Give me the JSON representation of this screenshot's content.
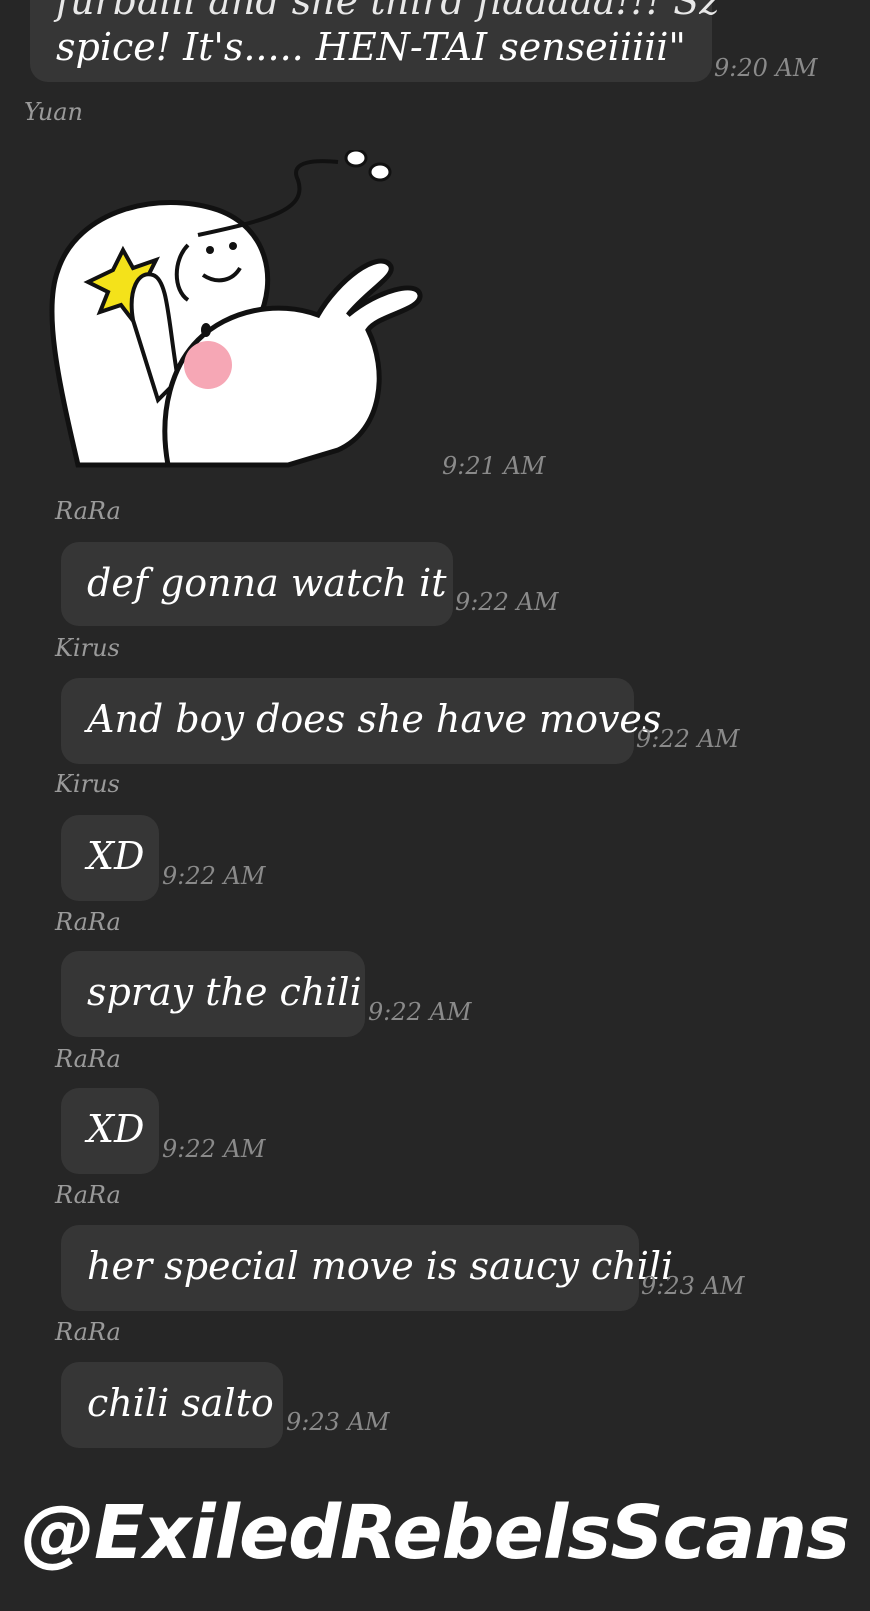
{
  "chat": {
    "top_message": {
      "line1": "furballl and she third flaaaaa!!! Sz",
      "line2": "spice! It's..... HEN-TAI senseiiiii\"",
      "time": "9:20 AM"
    },
    "sticker_message": {
      "sender": "Yuan",
      "time": "9:21 AM",
      "sticker_icon": "hug-sticker-icon"
    },
    "messages": [
      {
        "sender": "RaRa",
        "text": "def gonna watch it",
        "time": "9:22 AM"
      },
      {
        "sender": "Kirus",
        "text": "And boy does she have moves",
        "time": "9:22 AM"
      },
      {
        "sender": "Kirus",
        "text": "XD",
        "time": "9:22 AM"
      },
      {
        "sender": "RaRa",
        "text": "spray the chili",
        "time": "9:22 AM"
      },
      {
        "sender": "RaRa",
        "text": "XD",
        "time": "9:22 AM"
      },
      {
        "sender": "RaRa",
        "text": "her special move is saucy chili",
        "time": "9:23 AM"
      },
      {
        "sender": "RaRa",
        "text": "chili salto",
        "time": "9:23 AM"
      }
    ]
  },
  "watermark": {
    "text": "@ExiledRebelsScans"
  },
  "colors": {
    "background": "#262626",
    "bubble": "#363636",
    "text": "#ffffff",
    "timestamp": "#8a8a8a",
    "sender": "#9a9a9a"
  }
}
